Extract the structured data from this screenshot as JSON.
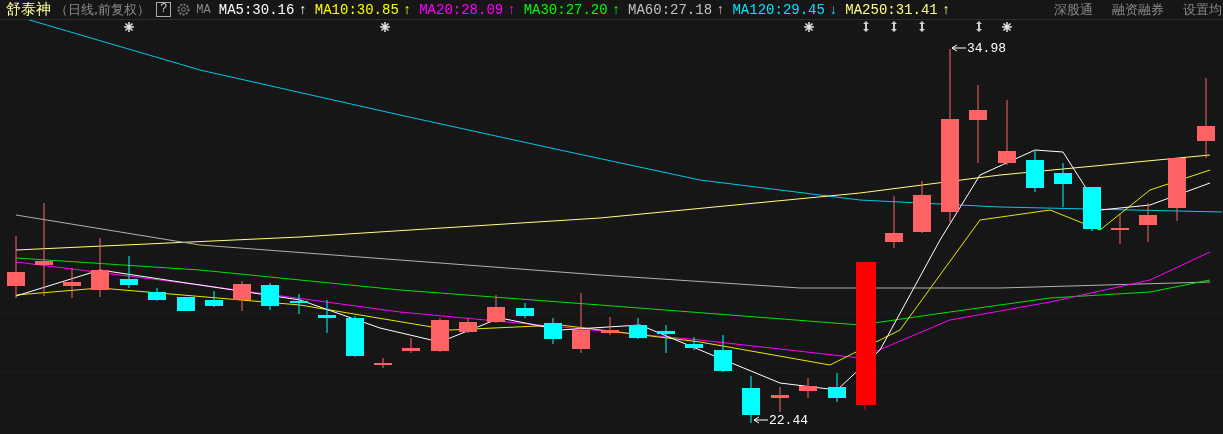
{
  "header": {
    "stock_name": "舒泰神",
    "mode": "（日线,前复权）",
    "help": "?",
    "indicator": "MA",
    "averages": [
      {
        "label": "MA5:30.16",
        "arrow": "↑",
        "color": "#ffffff"
      },
      {
        "label": "MA10:30.85",
        "arrow": "↑",
        "color": "#ffff00"
      },
      {
        "label": "MA20:28.09",
        "arrow": "↑",
        "color": "#ff00ff"
      },
      {
        "label": "MA30:27.20",
        "arrow": "↑",
        "color": "#00ff00"
      },
      {
        "label": "MA60:27.18",
        "arrow": "↑",
        "color": "#c0c0c0"
      },
      {
        "label": "MA120:29.45",
        "arrow": "↓",
        "color": "#00e5ff"
      },
      {
        "label": "MA250:31.41",
        "arrow": "↑",
        "color": "#ffff80"
      }
    ],
    "links": [
      "深股通",
      "融资融券",
      "设置均"
    ]
  },
  "chart": {
    "high_label": "34.98",
    "low_label": "22.44"
  }
}
